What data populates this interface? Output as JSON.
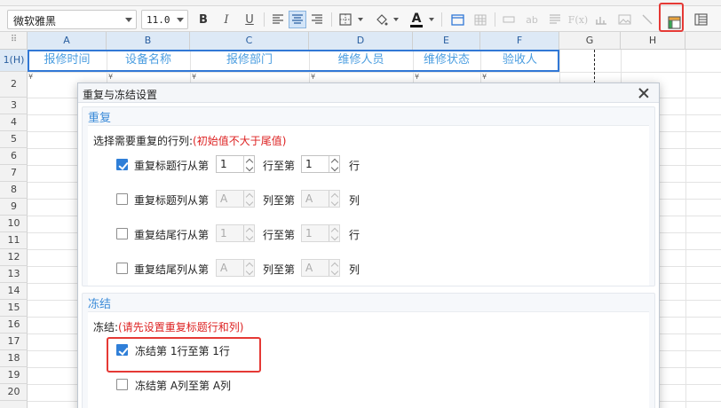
{
  "toolbar": {
    "font_name": "微软雅黑",
    "font_size": "11.0",
    "bold": "B",
    "italic": "I",
    "underline": "U",
    "text_color_glyph": "A",
    "accent": "#e53935"
  },
  "sheet": {
    "corner_label": "⠿",
    "columns": [
      "A",
      "B",
      "C",
      "D",
      "E",
      "F",
      "G",
      "H"
    ],
    "rows": [
      "1(H)",
      "2",
      "3",
      "4",
      "5",
      "6",
      "7",
      "8",
      "9",
      "10",
      "11",
      "12",
      "13",
      "14",
      "15",
      "16",
      "17",
      "18",
      "19",
      "20"
    ],
    "header_cells": [
      "报修时间",
      "设备名称",
      "报修部门",
      "维修人员",
      "维修状态",
      "验收人"
    ],
    "dropdown_mark": "¥",
    "header_text_color": "#4a9de0"
  },
  "dialog": {
    "title": "重复与冻结设置",
    "repeat": {
      "section_title": "重复",
      "prompt": "选择需要重复的行列:",
      "prompt_hint": "(初始值不大于尾值)",
      "options": [
        {
          "label": "重复标题行从第",
          "from": "1",
          "mid": "行至第",
          "to": "1",
          "unit": "行",
          "checked": true,
          "enabled": true
        },
        {
          "label": "重复标题列从第",
          "from": "A",
          "mid": "列至第",
          "to": "A",
          "unit": "列",
          "checked": false,
          "enabled": false
        },
        {
          "label": "重复结尾行从第",
          "from": "1",
          "mid": "行至第",
          "to": "1",
          "unit": "行",
          "checked": false,
          "enabled": false
        },
        {
          "label": "重复结尾列从第",
          "from": "A",
          "mid": "列至第",
          "to": "A",
          "unit": "列",
          "checked": false,
          "enabled": false
        }
      ]
    },
    "freeze": {
      "section_title": "冻结",
      "prompt": "冻结:",
      "prompt_hint": "(请先设置重复标题行和列)",
      "options": [
        {
          "label": "冻结第 1行至第 1行",
          "checked": true
        },
        {
          "label": "冻结第 A列至第 A列",
          "checked": false
        }
      ]
    }
  }
}
